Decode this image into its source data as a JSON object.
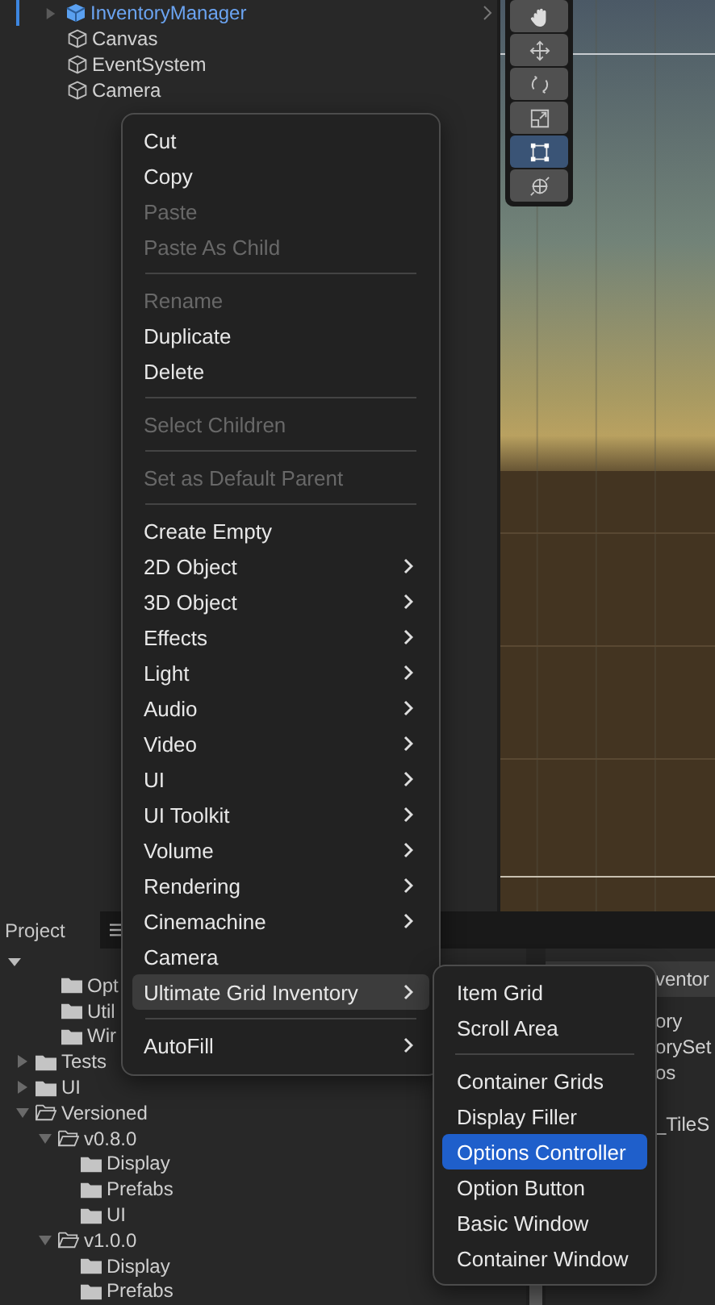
{
  "hierarchy": {
    "items": [
      {
        "label": "InventoryManager",
        "kind": "prefab"
      },
      {
        "label": "Canvas",
        "kind": "object"
      },
      {
        "label": "EventSystem",
        "kind": "object"
      },
      {
        "label": "Camera",
        "kind": "object"
      }
    ]
  },
  "scene": {
    "tools": [
      {
        "selected": false
      },
      {
        "selected": false
      },
      {
        "selected": false
      },
      {
        "selected": false
      },
      {
        "selected": true
      },
      {
        "selected": false
      }
    ]
  },
  "project": {
    "tabs": [
      {
        "label": "Project",
        "selected": true
      }
    ],
    "scrolled_children": [
      {
        "label": "Opt"
      },
      {
        "label": "Util"
      },
      {
        "label": "Wir"
      }
    ],
    "tree": [
      {
        "label": "Tests",
        "expanded": false
      },
      {
        "label": "UI",
        "expanded": false
      },
      {
        "label": "Versioned",
        "expanded": true,
        "children": [
          {
            "label": "v0.8.0",
            "expanded": true,
            "children": [
              {
                "label": "Display"
              },
              {
                "label": "Prefabs"
              },
              {
                "label": "UI"
              }
            ]
          },
          {
            "label": "v1.0.0",
            "expanded": true,
            "children": [
              {
                "label": "Display"
              },
              {
                "label": "Prefabs"
              }
            ]
          }
        ]
      }
    ]
  },
  "inspector": {
    "header": "ventor",
    "lines": [
      "ory",
      "orySet",
      "os",
      "_TileS"
    ]
  },
  "context_menu": {
    "items": [
      {
        "kind": "item",
        "label": "Cut",
        "disabled": false,
        "submenu": false,
        "selected": false
      },
      {
        "kind": "item",
        "label": "Copy",
        "disabled": false,
        "submenu": false,
        "selected": false
      },
      {
        "kind": "item",
        "label": "Paste",
        "disabled": true,
        "submenu": false,
        "selected": false
      },
      {
        "kind": "item",
        "label": "Paste As Child",
        "disabled": true,
        "submenu": false,
        "selected": false
      },
      {
        "kind": "separator"
      },
      {
        "kind": "item",
        "label": "Rename",
        "disabled": true,
        "submenu": false,
        "selected": false
      },
      {
        "kind": "item",
        "label": "Duplicate",
        "disabled": false,
        "submenu": false,
        "selected": false
      },
      {
        "kind": "item",
        "label": "Delete",
        "disabled": false,
        "submenu": false,
        "selected": false
      },
      {
        "kind": "separator"
      },
      {
        "kind": "item",
        "label": "Select Children",
        "disabled": true,
        "submenu": false,
        "selected": false
      },
      {
        "kind": "separator"
      },
      {
        "kind": "item",
        "label": "Set as Default Parent",
        "disabled": true,
        "submenu": false,
        "selected": false
      },
      {
        "kind": "separator"
      },
      {
        "kind": "item",
        "label": "Create Empty",
        "disabled": false,
        "submenu": false,
        "selected": false
      },
      {
        "kind": "item",
        "label": "2D Object",
        "disabled": false,
        "submenu": true,
        "selected": false
      },
      {
        "kind": "item",
        "label": "3D Object",
        "disabled": false,
        "submenu": true,
        "selected": false
      },
      {
        "kind": "item",
        "label": "Effects",
        "disabled": false,
        "submenu": true,
        "selected": false
      },
      {
        "kind": "item",
        "label": "Light",
        "disabled": false,
        "submenu": true,
        "selected": false
      },
      {
        "kind": "item",
        "label": "Audio",
        "disabled": false,
        "submenu": true,
        "selected": false
      },
      {
        "kind": "item",
        "label": "Video",
        "disabled": false,
        "submenu": true,
        "selected": false
      },
      {
        "kind": "item",
        "label": "UI",
        "disabled": false,
        "submenu": true,
        "selected": false
      },
      {
        "kind": "item",
        "label": "UI Toolkit",
        "disabled": false,
        "submenu": true,
        "selected": false
      },
      {
        "kind": "item",
        "label": "Volume",
        "disabled": false,
        "submenu": true,
        "selected": false
      },
      {
        "kind": "item",
        "label": "Rendering",
        "disabled": false,
        "submenu": true,
        "selected": false
      },
      {
        "kind": "item",
        "label": "Cinemachine",
        "disabled": false,
        "submenu": true,
        "selected": false
      },
      {
        "kind": "item",
        "label": "Camera",
        "disabled": false,
        "submenu": false,
        "selected": false
      },
      {
        "kind": "item",
        "label": "Ultimate Grid Inventory",
        "disabled": false,
        "submenu": true,
        "selected": true
      },
      {
        "kind": "separator"
      },
      {
        "kind": "item",
        "label": "AutoFill",
        "disabled": false,
        "submenu": true,
        "selected": false
      }
    ]
  },
  "submenu": {
    "items": [
      {
        "kind": "item",
        "label": "Item Grid",
        "selected": false
      },
      {
        "kind": "item",
        "label": "Scroll Area",
        "selected": false
      },
      {
        "kind": "separator"
      },
      {
        "kind": "item",
        "label": "Container Grids",
        "selected": false
      },
      {
        "kind": "item",
        "label": "Display Filler",
        "selected": false
      },
      {
        "kind": "item",
        "label": "Options Controller",
        "selected": true
      },
      {
        "kind": "item",
        "label": "Option Button",
        "selected": false
      },
      {
        "kind": "item",
        "label": "Basic Window",
        "selected": false
      },
      {
        "kind": "item",
        "label": "Container Window",
        "selected": false
      }
    ]
  }
}
